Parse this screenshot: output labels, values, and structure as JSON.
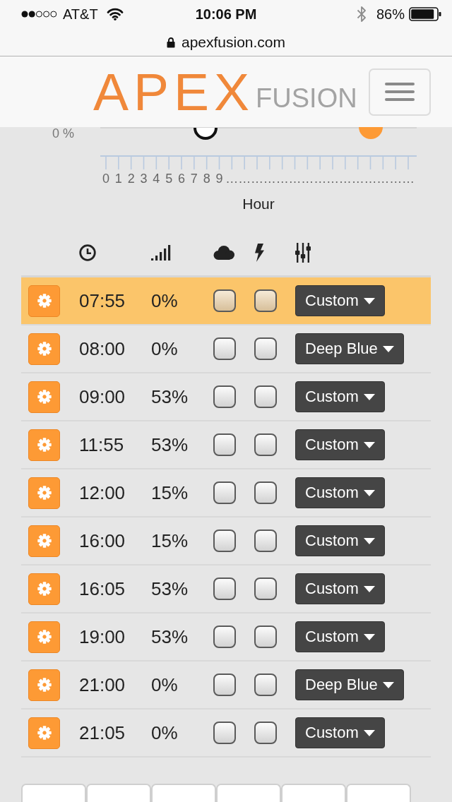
{
  "status_bar": {
    "carrier": "AT&T",
    "time": "10:06 PM",
    "battery": "86%"
  },
  "address_bar": {
    "url": "apexfusion.com"
  },
  "navbar": {
    "logo_main": "APEX",
    "logo_sub": "FUSION"
  },
  "chart": {
    "y_tick_label": "0 %",
    "x_tick_labels": [
      "0",
      "1",
      "2",
      "3",
      "4",
      "5",
      "6",
      "7",
      "8",
      "9",
      "…",
      "…",
      "…",
      "…",
      "…",
      "…",
      "…",
      "…",
      "…",
      "…",
      "…",
      "…",
      "…",
      "…",
      "…"
    ],
    "x_title": "Hour"
  },
  "table": {
    "rows": [
      {
        "time": "07:55",
        "intensity": "0%",
        "cloud": {
          "checked": false
        },
        "lightning": {
          "checked": false
        },
        "profile": "Custom",
        "selected": true
      },
      {
        "time": "08:00",
        "intensity": "0%",
        "cloud": {
          "checked": false
        },
        "lightning": {
          "checked": false
        },
        "profile": "Deep Blue",
        "selected": false
      },
      {
        "time": "09:00",
        "intensity": "53%",
        "cloud": {
          "checked": false
        },
        "lightning": {
          "checked": false
        },
        "profile": "Custom",
        "selected": false
      },
      {
        "time": "11:55",
        "intensity": "53%",
        "cloud": {
          "checked": false
        },
        "lightning": {
          "checked": false
        },
        "profile": "Custom",
        "selected": false
      },
      {
        "time": "12:00",
        "intensity": "15%",
        "cloud": {
          "checked": false
        },
        "lightning": {
          "checked": false
        },
        "profile": "Custom",
        "selected": false
      },
      {
        "time": "16:00",
        "intensity": "15%",
        "cloud": {
          "checked": false
        },
        "lightning": {
          "checked": false
        },
        "profile": "Custom",
        "selected": false
      },
      {
        "time": "16:05",
        "intensity": "53%",
        "cloud": {
          "checked": false
        },
        "lightning": {
          "checked": false
        },
        "profile": "Custom",
        "selected": false
      },
      {
        "time": "19:00",
        "intensity": "53%",
        "cloud": {
          "checked": false
        },
        "lightning": {
          "checked": false
        },
        "profile": "Custom",
        "selected": false
      },
      {
        "time": "21:00",
        "intensity": "0%",
        "cloud": {
          "checked": false
        },
        "lightning": {
          "checked": false
        },
        "profile": "Deep Blue",
        "selected": false
      },
      {
        "time": "21:05",
        "intensity": "0%",
        "cloud": {
          "checked": false
        },
        "lightning": {
          "checked": false
        },
        "profile": "Custom",
        "selected": false
      }
    ]
  }
}
